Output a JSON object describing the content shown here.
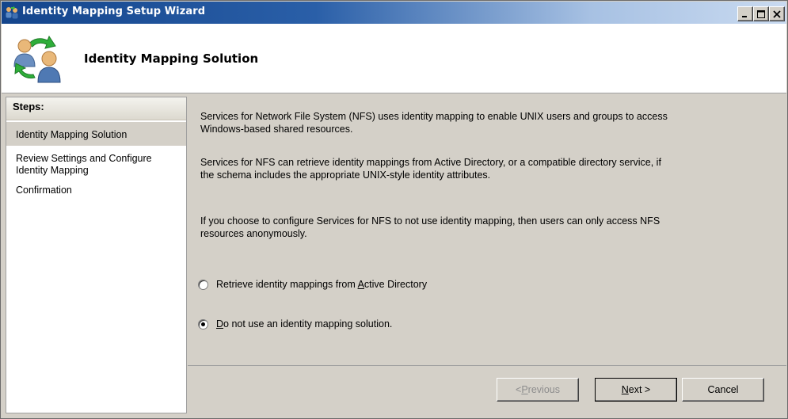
{
  "window": {
    "title": "Identity Mapping Setup Wizard",
    "icon": "wizard-users-icon"
  },
  "header": {
    "title": "Identity Mapping Solution",
    "icon": "users-sync-icon"
  },
  "steps": {
    "heading": "Steps:",
    "items": [
      {
        "label": "Identity Mapping Solution",
        "active": true
      },
      {
        "label": "Review Settings and Configure Identity Mapping",
        "active": false
      },
      {
        "label": "Confirmation",
        "active": false
      }
    ]
  },
  "content": {
    "paragraphs": [
      "Services for Network File System (NFS) uses identity mapping to enable UNIX users and groups to access Windows-based shared resources.",
      "Services for NFS can retrieve identity mappings from Active Directory, or a compatible directory service, if the schema includes the appropriate UNIX-style identity attributes.",
      "If you choose to configure Services for NFS to not use identity mapping, then users can only access NFS resources anonymously."
    ],
    "options": [
      {
        "pre": "Retrieve identity mappings from ",
        "accel": "A",
        "post": "ctive Directory",
        "checked": false
      },
      {
        "pre": "",
        "accel": "D",
        "post": "o not use an identity mapping solution.",
        "checked": true
      }
    ]
  },
  "footer": {
    "previous": {
      "pre": "< ",
      "accel": "P",
      "post": "revious",
      "enabled": false
    },
    "next": {
      "pre": "",
      "accel": "N",
      "post": "ext >",
      "enabled": true
    },
    "cancel": "Cancel"
  },
  "colors": {
    "titlebar_start": "#14458c",
    "titlebar_end": "#c9daf0",
    "dialog_bg": "#d4d0c8",
    "disabled_text": "#8d8d8d"
  }
}
